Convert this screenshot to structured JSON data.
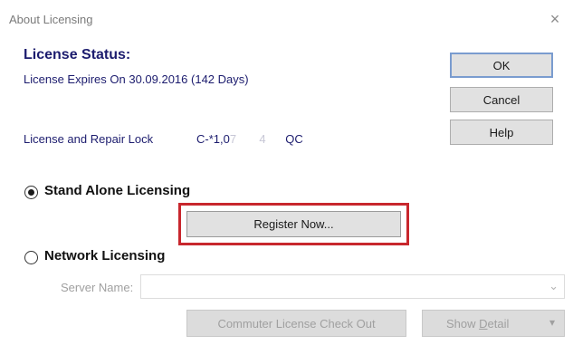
{
  "window": {
    "title": "About Licensing",
    "close_glyph": "×"
  },
  "license": {
    "status_title": "License Status:",
    "expires_text": "License Expires On 30.09.2016 (142 Days)",
    "lock_label": "License and Repair Lock",
    "lock_value_start": "C-*1,0",
    "lock_value_faded": "7       4      ",
    "lock_value_end": "QC"
  },
  "buttons": {
    "ok": "OK",
    "cancel": "Cancel",
    "help": "Help"
  },
  "standalone": {
    "label": "Stand Alone Licensing",
    "selected": true,
    "register_button": "Register Now..."
  },
  "network": {
    "label": "Network Licensing",
    "selected": false,
    "server_label": "Server Name:",
    "server_value": "",
    "commuter_button": "Commuter License Check Out",
    "show_detail_prefix": "Show ",
    "show_detail_underlined": "D",
    "show_detail_suffix": "etail",
    "chevron": "▾"
  },
  "colors": {
    "highlight": "#c8272d",
    "label_navy": "#1c1c6e",
    "ok_focus": "#7a9ccf"
  }
}
